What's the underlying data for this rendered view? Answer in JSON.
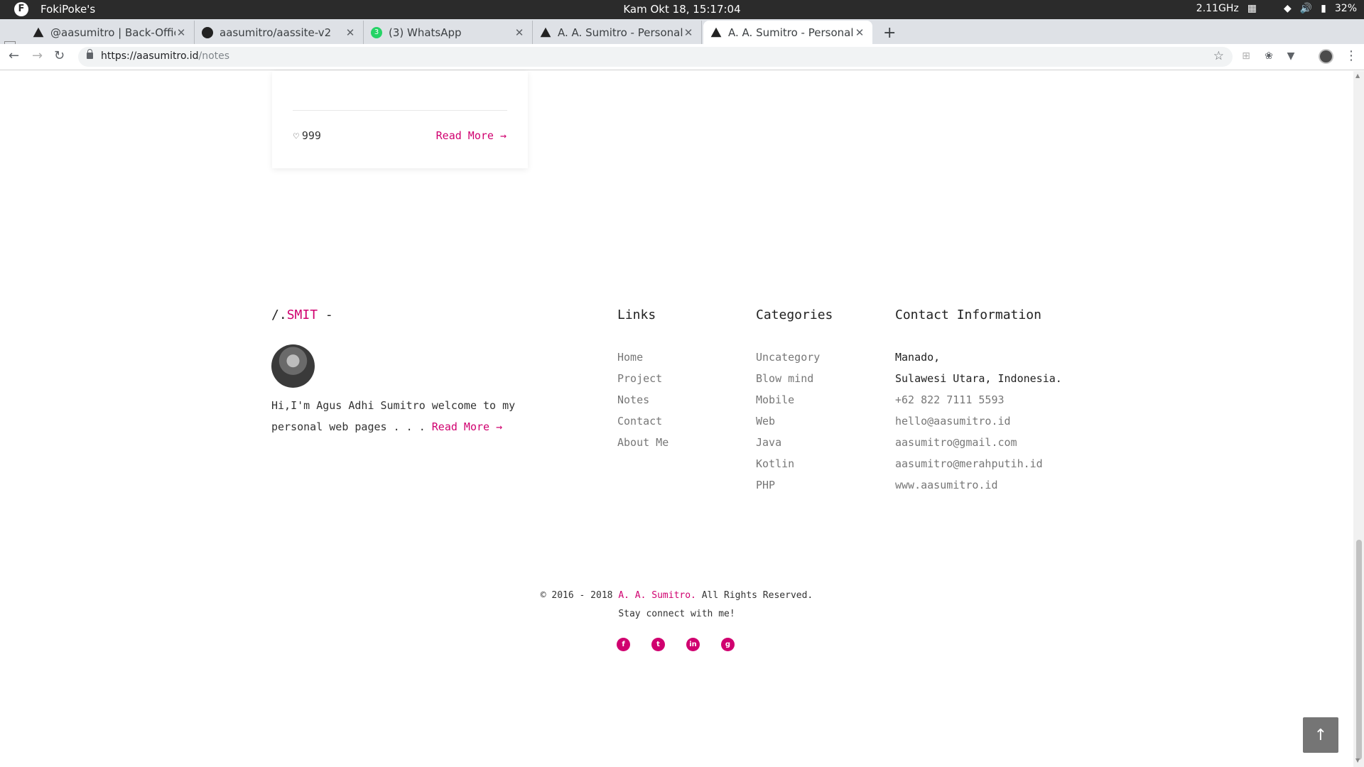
{
  "os": {
    "app_name": "FokiPoke's",
    "clock": "Kam Okt 18, 15:17:04",
    "cpu": "2.11GHz",
    "battery": "32%"
  },
  "tabs": [
    {
      "title": "@aasumitro | Back-Office[",
      "favicon": "triangle-logo-icon"
    },
    {
      "title": "aasumitro/aassite-v2",
      "favicon": "github-icon"
    },
    {
      "title": "(3) WhatsApp",
      "favicon": "whatsapp-icon",
      "badge": "3"
    },
    {
      "title": "A. A. Sumitro - Personal Pa",
      "favicon": "triangle-logo-icon"
    },
    {
      "title": "A. A. Sumitro - Personal Pa",
      "favicon": "triangle-logo-icon",
      "active": true
    }
  ],
  "address": {
    "host": "https://aasumitro.id",
    "path": "/notes"
  },
  "card": {
    "likes": "999",
    "read_more": "Read More"
  },
  "footer": {
    "brand_prefix": "/.",
    "brand_name": "SMIT",
    "brand_suffix": " -",
    "bio_text": "Hi,I'm Agus Adhi Sumitro welcome to my personal web pages . . . ",
    "bio_read_more": "Read More",
    "links_title": "Links",
    "links": [
      "Home",
      "Project",
      "Notes",
      "Contact",
      "About Me"
    ],
    "categories_title": "Categories",
    "categories": [
      "Uncategory",
      "Blow mind",
      "Mobile",
      "Web",
      "Java",
      "Kotlin",
      "PHP"
    ],
    "contact_title": "Contact Information",
    "contact": [
      "Manado,",
      "Sulawesi Utara, Indonesia.",
      "+62 822 7111 5593",
      "hello@aasumitro.id",
      "aasumitro@gmail.com",
      "aasumitro@merahputih.id",
      "www.aasumitro.id"
    ],
    "copyright_pre": "© 2016 - 2018 ",
    "copyright_name": "A. A. Sumitro.",
    "copyright_post": " All Rights Reserved.",
    "stay_connect": "Stay connect with me!",
    "socials": [
      {
        "name": "facebook-icon",
        "glyph": "f"
      },
      {
        "name": "twitter-icon",
        "glyph": "t"
      },
      {
        "name": "linkedin-icon",
        "glyph": "in"
      },
      {
        "name": "github-icon",
        "glyph": "g"
      }
    ]
  },
  "colors": {
    "accent": "#d0006f",
    "os_bar": "#2b2b2b",
    "tabstrip": "#dee1e6"
  }
}
